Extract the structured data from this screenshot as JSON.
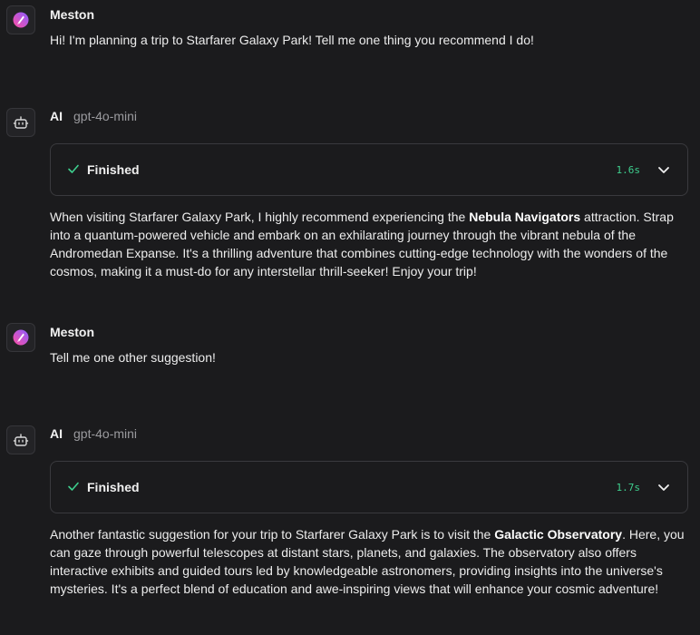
{
  "messages": [
    {
      "sender": "Meston",
      "text": "Hi! I'm planning a trip to Starfarer Galaxy Park! Tell me one thing you recommend I do!"
    },
    {
      "sender": "AI",
      "model": "gpt-4o-mini",
      "status": {
        "label": "Finished",
        "duration": "1.6s"
      },
      "text_before": "When visiting Starfarer Galaxy Park, I highly recommend experiencing the ",
      "highlight": "Nebula Navigators",
      "text_after": " attraction. Strap into a quantum-powered vehicle and embark on an exhilarating journey through the vibrant nebula of the Andromedan Expanse. It's a thrilling adventure that combines cutting-edge technology with the wonders of the cosmos, making it a must-do for any interstellar thrill-seeker! Enjoy your trip!"
    },
    {
      "sender": "Meston",
      "text": "Tell me one other suggestion!"
    },
    {
      "sender": "AI",
      "model": "gpt-4o-mini",
      "status": {
        "label": "Finished",
        "duration": "1.7s"
      },
      "text_before": "Another fantastic suggestion for your trip to Starfarer Galaxy Park is to visit the ",
      "highlight": "Galactic Observatory",
      "text_after": ". Here, you can gaze through powerful telescopes at distant stars, planets, and galaxies. The observatory also offers interactive exhibits and guided tours led by knowledgeable astronomers, providing insights into the universe's mysteries. It's a perfect blend of education and awe-inspiring views that will enhance your cosmic adventure!"
    }
  ],
  "icons": {
    "user_avatar": "rocket-gradient-icon",
    "ai_avatar": "robot-icon",
    "status_check": "check-icon",
    "expand": "chevron-down-icon"
  },
  "colors": {
    "background": "#1b1b1d",
    "duration_accent": "#3ecf8e",
    "check_accent": "#3ecf8e",
    "avatar_gradient_start": "#8a5cff",
    "avatar_gradient_end": "#ff4fa3"
  }
}
